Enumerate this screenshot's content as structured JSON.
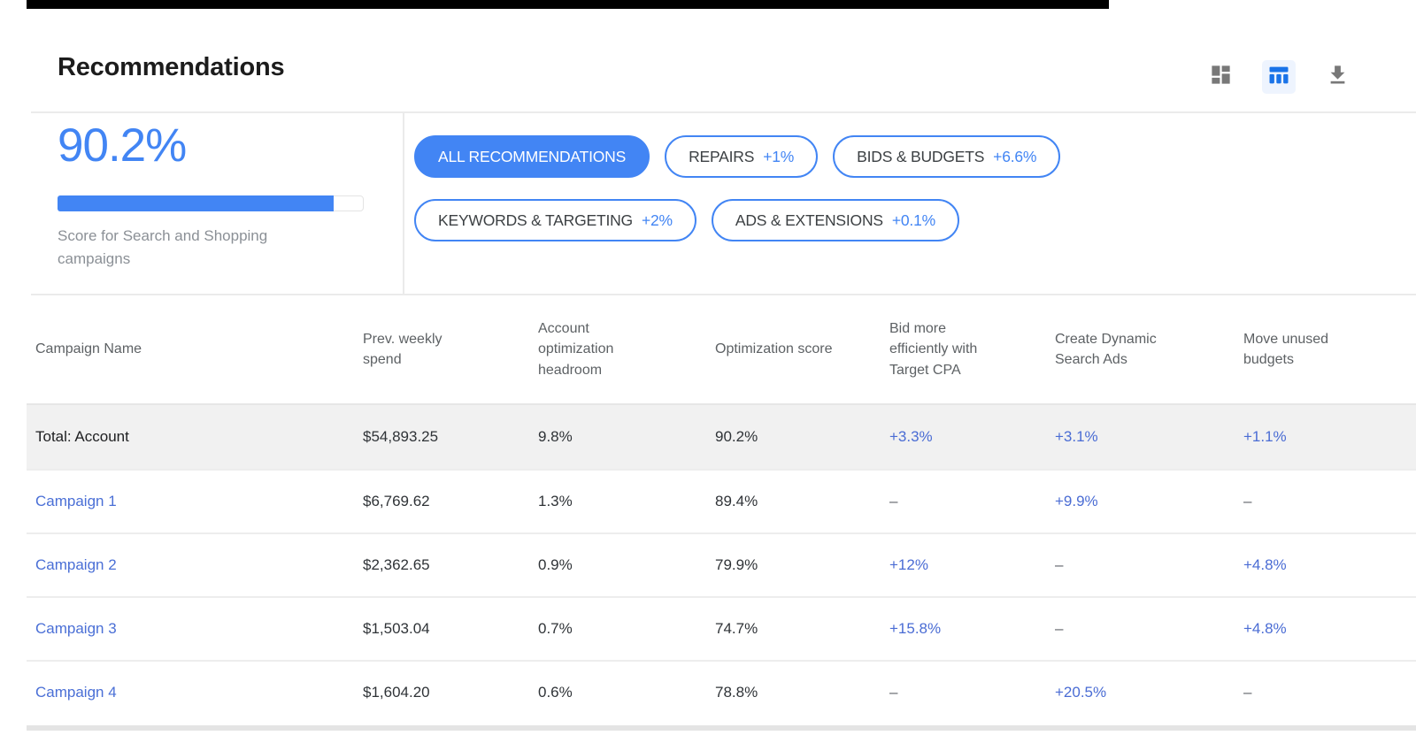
{
  "page": {
    "title": "Recommendations"
  },
  "toolbar": {
    "icons": [
      {
        "name": "dashboard-view",
        "color": "#787878",
        "active": false
      },
      {
        "name": "table-view",
        "color": "#1a73e8",
        "active": true
      },
      {
        "name": "download",
        "color": "#787878",
        "active": false
      }
    ]
  },
  "score": {
    "value": "90.2%",
    "percent": 90.2,
    "caption": "Score for Search and Shopping campaigns"
  },
  "filters": [
    {
      "label": "ALL RECOMMENDATIONS",
      "delta": "",
      "selected": true
    },
    {
      "label": "REPAIRS",
      "delta": "+1%",
      "selected": false
    },
    {
      "label": "BIDS & BUDGETS",
      "delta": "+6.6%",
      "selected": false
    },
    {
      "label": "KEYWORDS & TARGETING",
      "delta": "+2%",
      "selected": false
    },
    {
      "label": "ADS & EXTENSIONS",
      "delta": "+0.1%",
      "selected": false
    }
  ],
  "table": {
    "columns": [
      "Campaign Name",
      "Prev. weekly spend",
      "Account optimization headroom",
      "Optimization score",
      "Bid more efficiently with Target CPA",
      "Create Dynamic Search Ads",
      "Move unused budgets"
    ],
    "rows": [
      {
        "name": "Total: Account",
        "is_link": false,
        "is_total": true,
        "cells": [
          "$54,893.25",
          "9.8%",
          "90.2%",
          "+3.3%",
          "+3.1%",
          "+1.1%"
        ]
      },
      {
        "name": "Campaign 1",
        "is_link": true,
        "is_total": false,
        "cells": [
          "$6,769.62",
          "1.3%",
          "89.4%",
          "–",
          "+9.9%",
          "–"
        ]
      },
      {
        "name": "Campaign 2",
        "is_link": true,
        "is_total": false,
        "cells": [
          "$2,362.65",
          "0.9%",
          "79.9%",
          "+12%",
          "–",
          "+4.8%"
        ]
      },
      {
        "name": "Campaign 3",
        "is_link": true,
        "is_total": false,
        "cells": [
          "$1,503.04",
          "0.7%",
          "74.7%",
          "+15.8%",
          "–",
          "+4.8%"
        ]
      },
      {
        "name": "Campaign 4",
        "is_link": true,
        "is_total": false,
        "cells": [
          "$1,604.20",
          "0.6%",
          "78.8%",
          "–",
          "+20.5%",
          "–"
        ]
      }
    ]
  },
  "colors": {
    "accent": "#4285f4",
    "link": "#4a6fd6",
    "uplift": "#4a6cd4",
    "muted": "#8b9096",
    "total_row_bg": "#f1f1f1"
  }
}
